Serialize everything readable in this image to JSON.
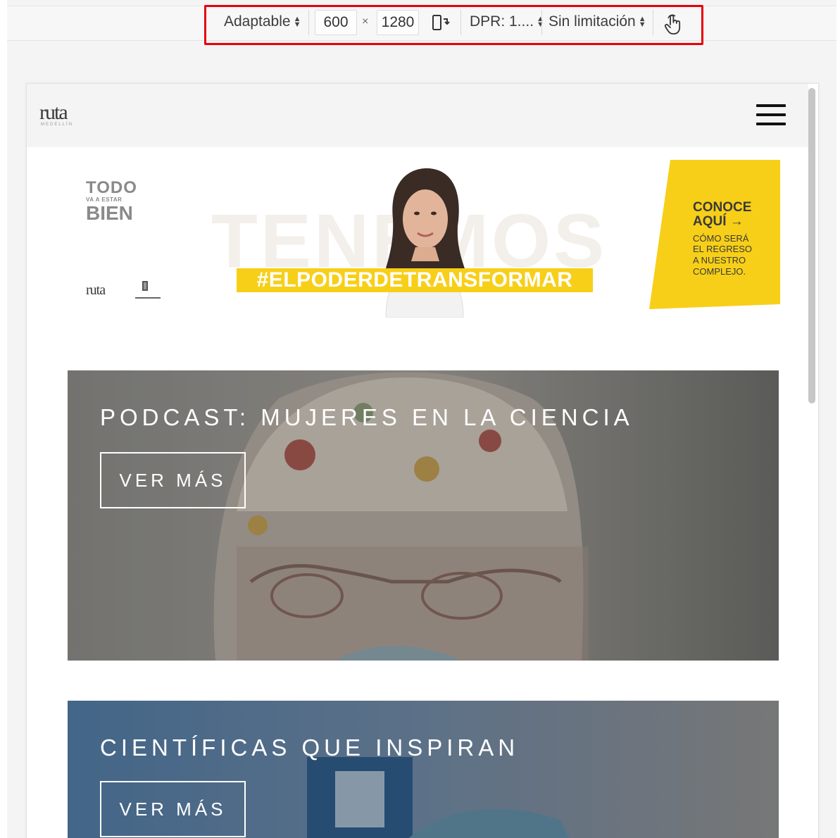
{
  "devtools": {
    "device": "Adaptable",
    "width": "600",
    "times": "×",
    "height": "1280",
    "dpr": "DPR: 1....",
    "throttling": "Sin limitación"
  },
  "site": {
    "logo": "ruta",
    "logo_sub": "MEDELLÍN"
  },
  "banner": {
    "todo_line1": "TODO",
    "todo_line2": "VA A ESTAR",
    "todo_line3": "BIEN",
    "bigword": "TENEMOS",
    "hashtag": "#ELPODERDETRANSFORMAR",
    "cta_heading_1": "CONOCE",
    "cta_heading_2": "AQUÍ →",
    "cta_sub_1": "CÓMO SERÁ",
    "cta_sub_2": "EL REGRESO",
    "cta_sub_3": "A NUESTRO",
    "cta_sub_4": "COMPLEJO.",
    "small_logo": "ruta"
  },
  "cards": [
    {
      "title": "PODCAST: MUJERES EN LA CIENCIA",
      "button": "VER MÁS"
    },
    {
      "title": "CIENTÍFICAS QUE INSPIRAN",
      "button": "VER MÁS"
    }
  ],
  "colors": {
    "highlight": "#e8000e",
    "brand_yellow": "#f7cf18"
  }
}
